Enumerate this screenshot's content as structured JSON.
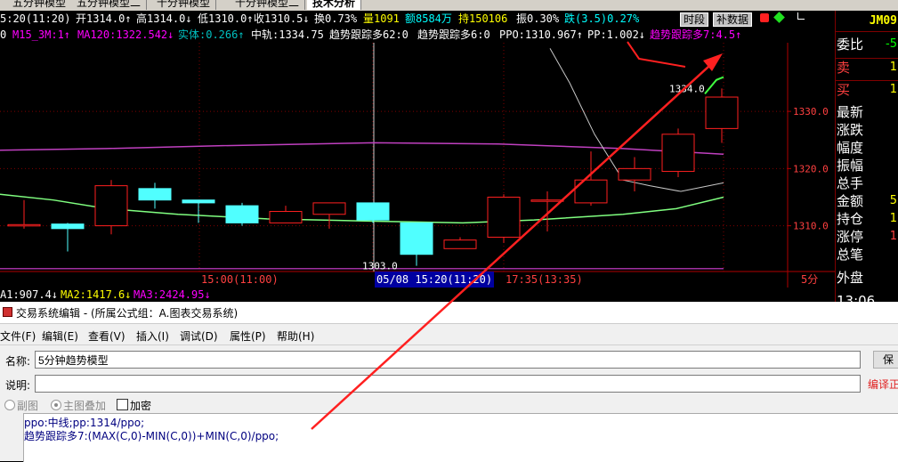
{
  "tabs": [
    "五分钟模型",
    "五分钟模型二",
    "十分钟模型",
    "十分钟模型二",
    "技术分析"
  ],
  "quote": {
    "time": "5:20(11:20)",
    "open": "开1314.0↑",
    "high": "高1314.0↓",
    "low": "低1310.0↑",
    "close": "收1310.5↓",
    "turnover": "换0.73%",
    "volume": "量1091",
    "amount": "额8584万",
    "position": "持150106",
    "amplitude": "振0.30%",
    "change": "跌(3.5)0.27%",
    "btn_time": "时段",
    "btn_fill": "补数据"
  },
  "indicators": [
    {
      "text": "0",
      "color": "#ffffff"
    },
    {
      "text": "M15_3M:1↑",
      "color": "#ff00ff"
    },
    {
      "text": "MA120:1322.542↓",
      "color": "#ff00ff"
    },
    {
      "text": "实体:0.266↑",
      "color": "#00c0c0"
    },
    {
      "text": "中轨:1334.75",
      "color": "#ffffff"
    },
    {
      "text": "趋势跟踪多62:0",
      "color": "#ffffff"
    },
    {
      "text": "趋势跟踪多6:0",
      "color": "#ffffff"
    },
    {
      "text": "PPO:1310.967↑",
      "color": "#ffffff"
    },
    {
      "text": "PP:1.002↓",
      "color": "#ffffff"
    },
    {
      "text": "趋势跟踪多7:4.5↑",
      "color": "#ff00ff"
    }
  ],
  "chart_data": {
    "type": "candlestick",
    "y_ticks": [
      1330.0,
      1320.0,
      1310.0
    ],
    "ylim": [
      1302,
      1342
    ],
    "candles": [
      {
        "open": 1310.0,
        "close": 1310.2,
        "high": 1314.5,
        "low": 1309.5
      },
      {
        "open": 1310.3,
        "close": 1309.5,
        "high": 1310.5,
        "low": 1305.5
      },
      {
        "open": 1310.0,
        "close": 1317.0,
        "high": 1318.0,
        "low": 1308.5
      },
      {
        "open": 1316.5,
        "close": 1314.5,
        "high": 1317.5,
        "low": 1313.0
      },
      {
        "open": 1314.5,
        "close": 1314.0,
        "high": 1314.5,
        "low": 1310.5
      },
      {
        "open": 1313.5,
        "close": 1310.5,
        "high": 1314.0,
        "low": 1310.0
      },
      {
        "open": 1310.5,
        "close": 1312.5,
        "high": 1313.5,
        "low": 1310.5
      },
      {
        "open": 1312.0,
        "close": 1314.0,
        "high": 1314.0,
        "low": 1309.5
      },
      {
        "open": 1314.0,
        "close": 1311.0,
        "high": 1314.0,
        "low": 1310.5
      },
      {
        "open": 1310.5,
        "close": 1305.0,
        "high": 1310.5,
        "low": 1303.0
      },
      {
        "open": 1306.0,
        "close": 1307.5,
        "high": 1308.0,
        "low": 1306.0
      },
      {
        "open": 1308.0,
        "close": 1315.0,
        "high": 1315.5,
        "low": 1307.0
      },
      {
        "open": 1314.5,
        "close": 1314.5,
        "high": 1316.0,
        "low": 1309.0
      },
      {
        "open": 1314.0,
        "close": 1318.0,
        "high": 1323.0,
        "low": 1313.5
      },
      {
        "open": 1318.0,
        "close": 1320.0,
        "high": 1322.0,
        "low": 1316.0
      },
      {
        "open": 1319.5,
        "close": 1326.0,
        "high": 1327.0,
        "low": 1318.5
      },
      {
        "open": 1327.0,
        "close": 1332.5,
        "high": 1334.0,
        "low": 1324.5
      }
    ],
    "labels": {
      "high": "1334.0",
      "low": "1303.0"
    },
    "time_labels": [
      "15:00(11:00)",
      "05/08 15:20(11:20)",
      "17:35(13:35)"
    ],
    "period": "5分",
    "ma_text": [
      {
        "text": "A1:907.4↓",
        "color": "#ffffff"
      },
      {
        "text": "MA2:1417.6↓",
        "color": "#ffff00"
      },
      {
        "text": "MA3:2424.95↓",
        "color": "#ff00ff"
      }
    ]
  },
  "right_panel": {
    "title": "JM09",
    "rows": [
      {
        "label": "委比",
        "value": "-5",
        "color": "#00ff00"
      },
      {
        "label": "卖",
        "value": "1",
        "color": "#ffff00"
      },
      {
        "label": "买",
        "value": "1",
        "color": "#ffff00"
      },
      {
        "label": "最新",
        "value": ""
      },
      {
        "label": "涨跌",
        "value": ""
      },
      {
        "label": "幅度",
        "value": ""
      },
      {
        "label": "振幅",
        "value": ""
      },
      {
        "label": "总手",
        "value": ""
      },
      {
        "label": "金额",
        "value": "5",
        "color": "#ffff00"
      },
      {
        "label": "持仓",
        "value": "1",
        "color": "#ffff00"
      },
      {
        "label": "涨停",
        "value": "1",
        "color": "#ff4040"
      },
      {
        "label": "总笔",
        "value": ""
      },
      {
        "label": "外盘",
        "value": ""
      },
      {
        "label": "13:06",
        "value": ""
      }
    ]
  },
  "editor": {
    "title": "交易系统编辑 - (所属公式组：A.图表交易系统)",
    "menu": [
      "文件(F)",
      "编辑(E)",
      "查看(V)",
      "插入(I)",
      "调试(D)",
      "属性(P)",
      "帮助(H)"
    ],
    "name_label": "名称:",
    "name_value": "5分钟趋势模型",
    "desc_label": "说明:",
    "desc_value": "",
    "btn_save": "保",
    "compile_status": "编译正",
    "radio_sub": "副图",
    "radio_main": "主图叠加",
    "checkbox_encrypt": "加密",
    "code_lines": [
      "ppo:中线;pp:1314/ppo;",
      "趋势跟踪多7:(MAX(C,0)-MIN(C,0))+MIN(C,0)/ppo;"
    ]
  }
}
